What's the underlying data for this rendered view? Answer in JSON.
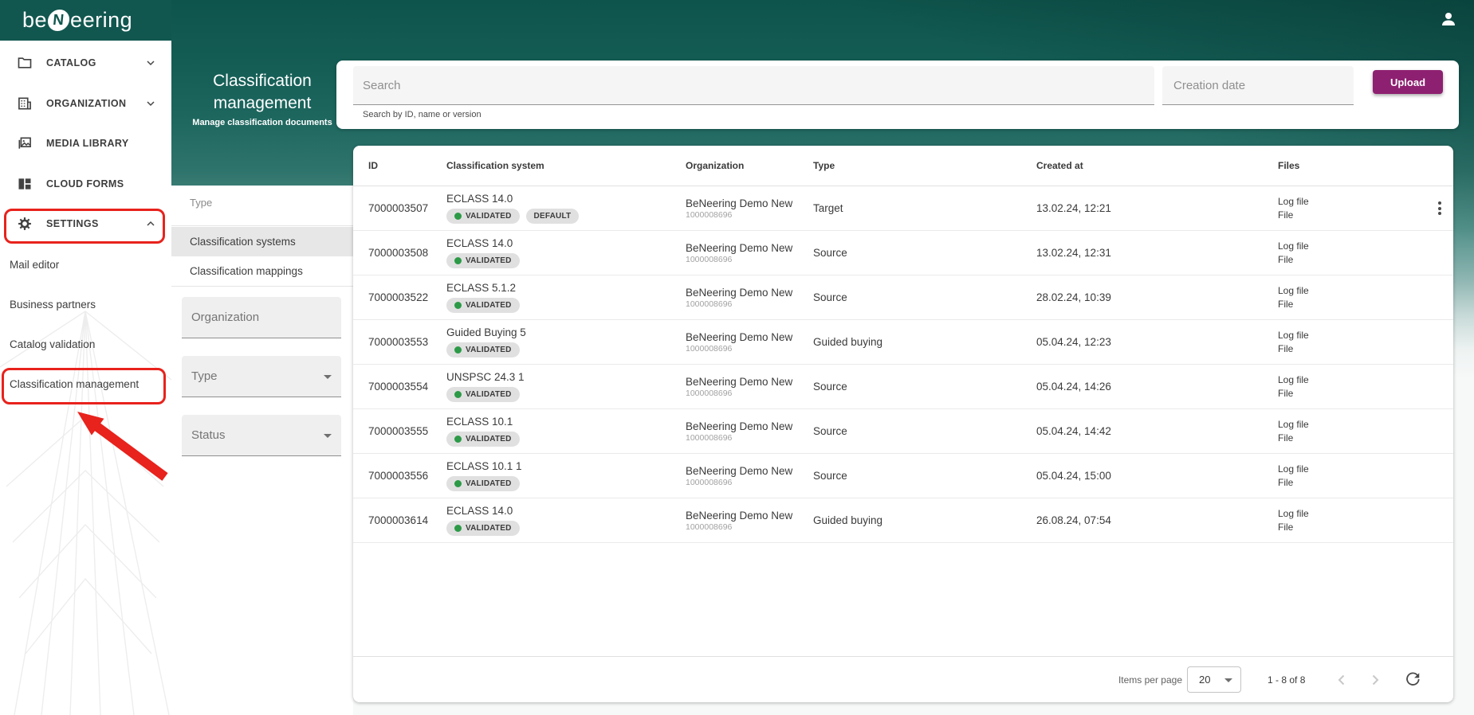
{
  "topbar": {
    "logo_prefix": "be",
    "logo_mark": "N",
    "logo_suffix": "eering",
    "user_icon": "person-icon"
  },
  "sidebar": {
    "main_items": [
      {
        "label": "CATALOG",
        "icon": "folder-icon",
        "chevron": "down"
      },
      {
        "label": "ORGANIZATION",
        "icon": "building-icon",
        "chevron": "down"
      },
      {
        "label": "MEDIA LIBRARY",
        "icon": "media-library-icon",
        "chevron": ""
      },
      {
        "label": "CLOUD FORMS",
        "icon": "cloud-forms-icon",
        "chevron": ""
      },
      {
        "label": "SETTINGS",
        "icon": "gear-icon",
        "chevron": "up"
      }
    ],
    "sub_items": [
      {
        "label": "Mail editor"
      },
      {
        "label": "Business partners"
      },
      {
        "label": "Catalog validation"
      },
      {
        "label": "Classification management"
      }
    ]
  },
  "annotations": {
    "highlighted_items": [
      "SETTINGS",
      "Classification management"
    ],
    "arrow_points_to": "Classification management"
  },
  "header": {
    "title_line1": "Classification",
    "title_line2": "management",
    "subtitle": "Manage classification documents"
  },
  "filters": {
    "group_label": "Type",
    "tabs": [
      {
        "label": "Classification systems",
        "selected": true
      },
      {
        "label": "Classification mappings",
        "selected": false
      }
    ],
    "fields": [
      {
        "placeholder": "Organization",
        "kind": "text"
      },
      {
        "placeholder": "Type",
        "kind": "select"
      },
      {
        "placeholder": "Status",
        "kind": "select"
      }
    ]
  },
  "search": {
    "placeholder": "Search",
    "hint": "Search by ID, name or version",
    "date_placeholder": "Creation date",
    "upload_label": "Upload"
  },
  "table": {
    "columns": [
      "ID",
      "Classification system",
      "Organization",
      "Type",
      "Created at",
      "Files"
    ],
    "rows": [
      {
        "id": "7000003507",
        "system": "ECLASS 14.0",
        "badges": [
          "VALIDATED",
          "DEFAULT"
        ],
        "org": "BeNeering Demo New",
        "org_id": "1000008696",
        "type": "Target",
        "created": "13.02.24, 12:21",
        "files": [
          "Log file",
          "File"
        ],
        "menu": true
      },
      {
        "id": "7000003508",
        "system": "ECLASS 14.0",
        "badges": [
          "VALIDATED"
        ],
        "org": "BeNeering Demo New",
        "org_id": "1000008696",
        "type": "Source",
        "created": "13.02.24, 12:31",
        "files": [
          "Log file",
          "File"
        ],
        "menu": false
      },
      {
        "id": "7000003522",
        "system": "ECLASS 5.1.2",
        "badges": [
          "VALIDATED"
        ],
        "org": "BeNeering Demo New",
        "org_id": "1000008696",
        "type": "Source",
        "created": "28.02.24, 10:39",
        "files": [
          "Log file",
          "File"
        ],
        "menu": false
      },
      {
        "id": "7000003553",
        "system": "Guided Buying 5",
        "badges": [
          "VALIDATED"
        ],
        "org": "BeNeering Demo New",
        "org_id": "1000008696",
        "type": "Guided buying",
        "created": "05.04.24, 12:23",
        "files": [
          "Log file",
          "File"
        ],
        "menu": false
      },
      {
        "id": "7000003554",
        "system": "UNSPSC 24.3 1",
        "badges": [
          "VALIDATED"
        ],
        "org": "BeNeering Demo New",
        "org_id": "1000008696",
        "type": "Source",
        "created": "05.04.24, 14:26",
        "files": [
          "Log file",
          "File"
        ],
        "menu": false
      },
      {
        "id": "7000003555",
        "system": "ECLASS 10.1",
        "badges": [
          "VALIDATED"
        ],
        "org": "BeNeering Demo New",
        "org_id": "1000008696",
        "type": "Source",
        "created": "05.04.24, 14:42",
        "files": [
          "Log file",
          "File"
        ],
        "menu": false
      },
      {
        "id": "7000003556",
        "system": "ECLASS 10.1 1",
        "badges": [
          "VALIDATED"
        ],
        "org": "BeNeering Demo New",
        "org_id": "1000008696",
        "type": "Source",
        "created": "05.04.24, 15:00",
        "files": [
          "Log file",
          "File"
        ],
        "menu": false
      },
      {
        "id": "7000003614",
        "system": "ECLASS 14.0",
        "badges": [
          "VALIDATED"
        ],
        "org": "BeNeering Demo New",
        "org_id": "1000008696",
        "type": "Guided buying",
        "created": "26.08.24, 07:54",
        "files": [
          "Log file",
          "File"
        ],
        "menu": false
      }
    ]
  },
  "pagination": {
    "items_per_page_label": "Items per page",
    "page_size": "20",
    "range_label": "1 - 8 of 8"
  },
  "colors": {
    "brand_teal": "#11574f",
    "upload_purple": "#8e2071",
    "validated_green": "#2c9a47",
    "annotation_red": "#e8221c"
  }
}
